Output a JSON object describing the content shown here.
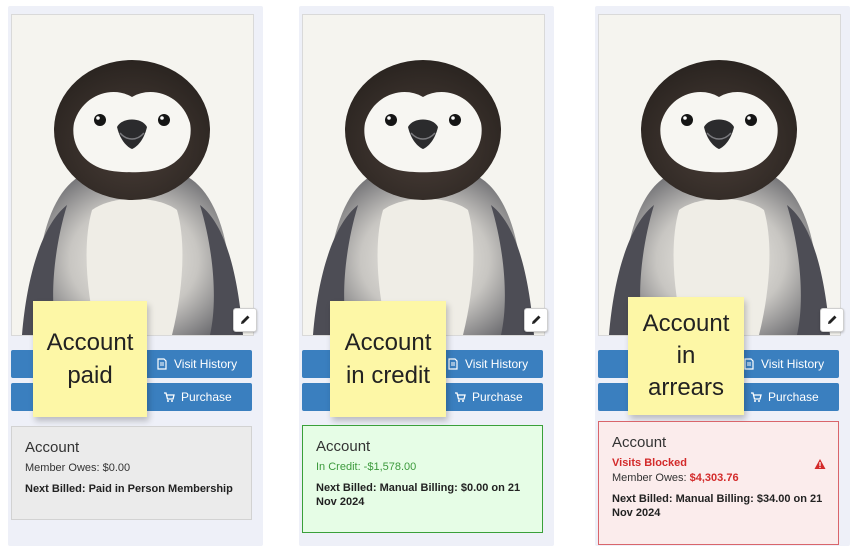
{
  "colors": {
    "button_blue": "#3a7fbf",
    "sticky_yellow": "#fdf7a6",
    "paid_bg": "#ebebeb",
    "credit_bg": "#e6fde6",
    "credit_border": "#3aa03a",
    "credit_text": "#3c9a3c",
    "arrears_bg": "#fbecec",
    "arrears_border": "#d9656b",
    "arrears_text": "#d32a2a"
  },
  "panels": [
    {
      "sticky_note_lines": [
        "Account",
        "paid"
      ],
      "visit_history_label": "Visit History",
      "purchase_label": "Purchase",
      "account": {
        "title": "Account",
        "owes_line": "Member Owes: $0.00",
        "next_billed": "Next Billed: Paid in Person Membership"
      }
    },
    {
      "sticky_note_lines": [
        "Account",
        "in credit"
      ],
      "visit_history_label": "Visit History",
      "purchase_label": "Purchase",
      "account": {
        "title": "Account",
        "credit_line": "In Credit: -$1,578.00",
        "next_billed": "Next Billed: Manual Billing: $0.00 on 21 Nov 2024"
      }
    },
    {
      "sticky_note_lines": [
        "Account",
        "in",
        "arrears"
      ],
      "visit_history_label": "Visit History",
      "purchase_label": "Purchase",
      "account": {
        "title": "Account",
        "status": "Visits Blocked",
        "owes_label": "Member Owes:",
        "owes_amount": "$4,303.76",
        "next_billed": "Next Billed: Manual Billing: $34.00 on 21 Nov 2024"
      }
    }
  ],
  "icons": {
    "edit": "pencil-icon",
    "visit_history": "document-icon",
    "purchase": "cart-icon",
    "warning": "warning-triangle-icon"
  }
}
